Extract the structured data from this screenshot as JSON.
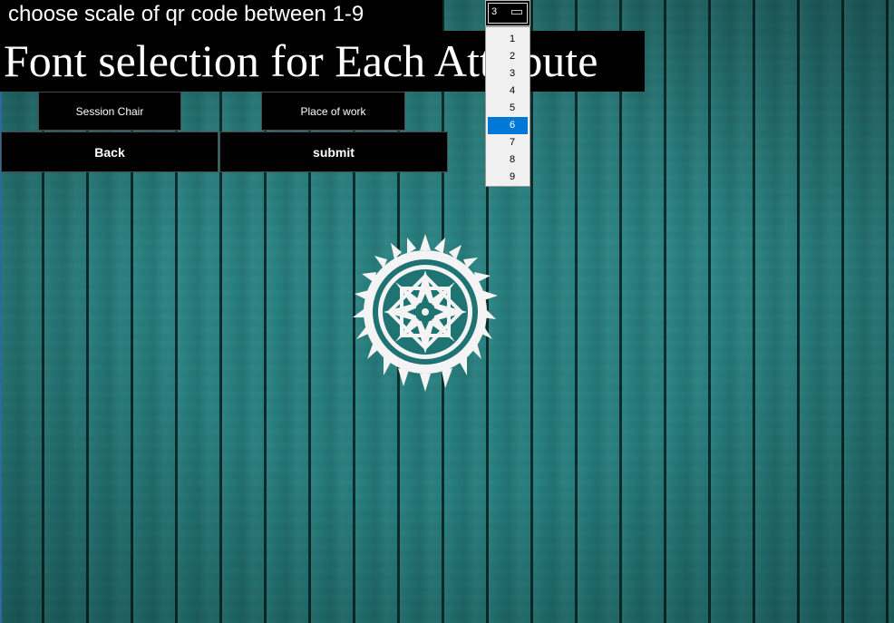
{
  "scale_label": "choose scale of qr code between 1-9",
  "heading": "Font selection for Each Attribute",
  "buttons": {
    "session_chair": "Session Chair",
    "place_of_work": "Place of work",
    "back": "Back",
    "submit": "submit"
  },
  "scale_combo": {
    "value": "3",
    "options": [
      "1",
      "2",
      "3",
      "4",
      "5",
      "6",
      "7",
      "8",
      "9"
    ],
    "highlighted": "6"
  },
  "emblem_icon": "sun-emblem-icon",
  "colors": {
    "background": "#237878",
    "label_bg": "#000000",
    "highlight": "#0078d7"
  }
}
